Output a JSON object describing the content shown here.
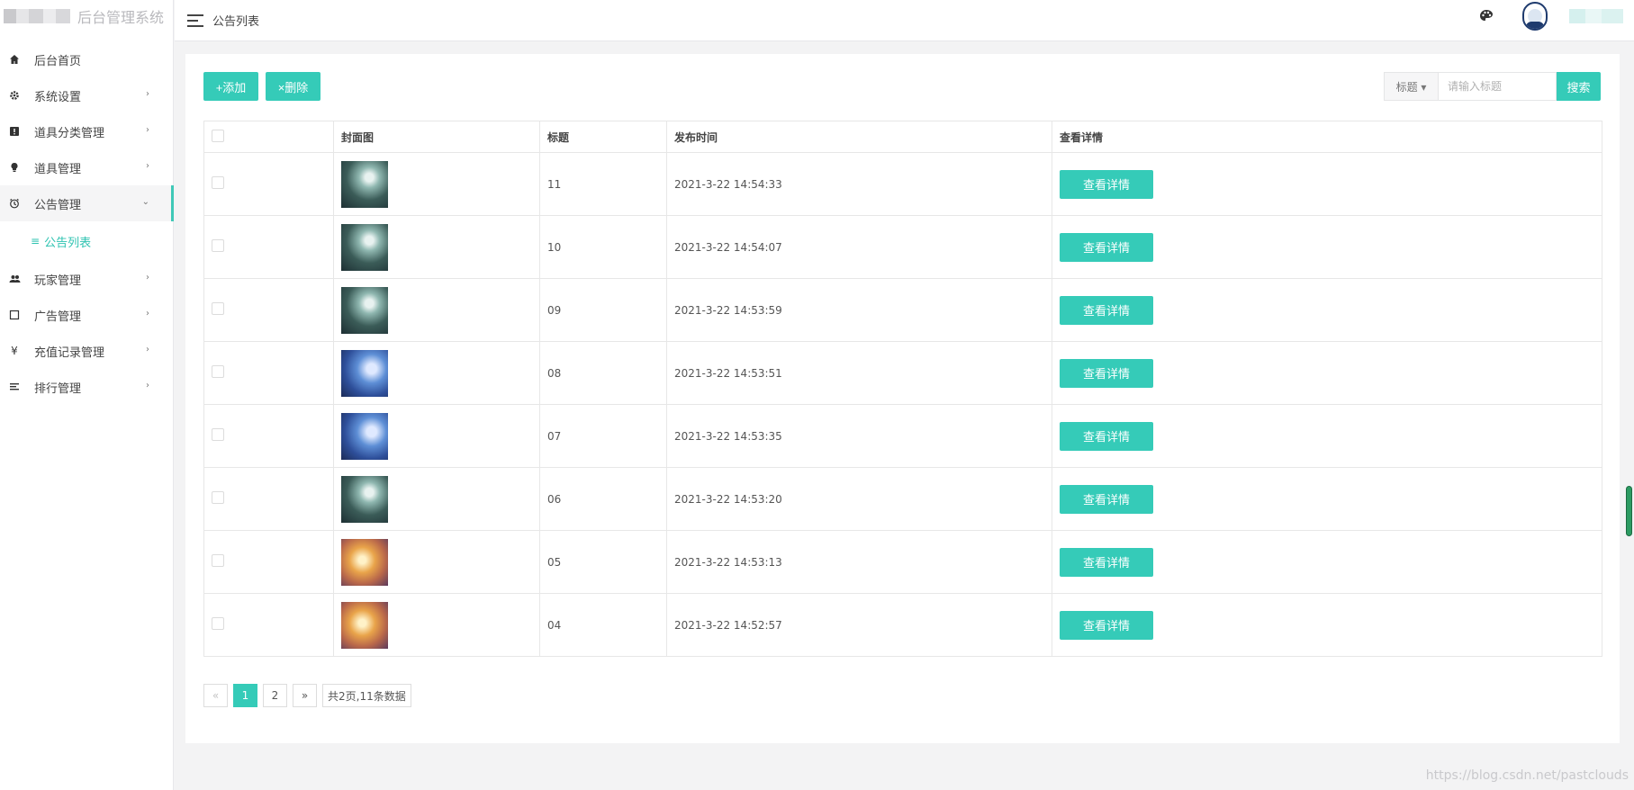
{
  "brand": {
    "title": "后台管理系统"
  },
  "sidebar": {
    "items": [
      {
        "label": "后台首页",
        "icon": "home-icon",
        "has_children": false
      },
      {
        "label": "系统设置",
        "icon": "gear-icon",
        "has_children": true
      },
      {
        "label": "道具分类管理",
        "icon": "alert-icon",
        "has_children": true
      },
      {
        "label": "道具管理",
        "icon": "bulb-icon",
        "has_children": true
      },
      {
        "label": "公告管理",
        "icon": "clock-icon",
        "has_children": true,
        "expanded": true,
        "active": true
      },
      {
        "label": "玩家管理",
        "icon": "users-icon",
        "has_children": true
      },
      {
        "label": "广告管理",
        "icon": "square-icon",
        "has_children": true
      },
      {
        "label": "充值记录管理",
        "icon": "yen-icon",
        "has_children": true
      },
      {
        "label": "排行管理",
        "icon": "list-icon",
        "has_children": true
      }
    ],
    "submenu": {
      "label": "公告列表",
      "icon": "list-icon"
    }
  },
  "topbar": {
    "crumb": "公告列表"
  },
  "toolbar": {
    "add_label": "+添加",
    "delete_label": "×删除"
  },
  "search": {
    "field_label": "标题 ▾",
    "placeholder": "请输入标题",
    "button_label": "搜索"
  },
  "table": {
    "columns": [
      "",
      "封面图",
      "标题",
      "发布时间",
      "查看详情"
    ],
    "detail_label": "查看详情",
    "rows": [
      {
        "title": "11",
        "time": "2021-3-22 14:54:33",
        "thumb": "t1"
      },
      {
        "title": "10",
        "time": "2021-3-22 14:54:07",
        "thumb": "t1"
      },
      {
        "title": "09",
        "time": "2021-3-22 14:53:59",
        "thumb": "t1"
      },
      {
        "title": "08",
        "time": "2021-3-22 14:53:51",
        "thumb": "t2"
      },
      {
        "title": "07",
        "time": "2021-3-22 14:53:35",
        "thumb": "t2"
      },
      {
        "title": "06",
        "time": "2021-3-22 14:53:20",
        "thumb": "t1"
      },
      {
        "title": "05",
        "time": "2021-3-22 14:53:13",
        "thumb": "t3"
      },
      {
        "title": "04",
        "time": "2021-3-22 14:52:57",
        "thumb": "t3"
      }
    ]
  },
  "pagination": {
    "prev": "«",
    "pages": [
      "1",
      "2"
    ],
    "current": "1",
    "next": "»",
    "info": "共2页,11条数据"
  },
  "watermark": "https://blog.csdn.net/pastclouds",
  "colors": {
    "accent": "#35cbb8",
    "time": "#34b58f",
    "active_sub": "#2fc3b1"
  }
}
